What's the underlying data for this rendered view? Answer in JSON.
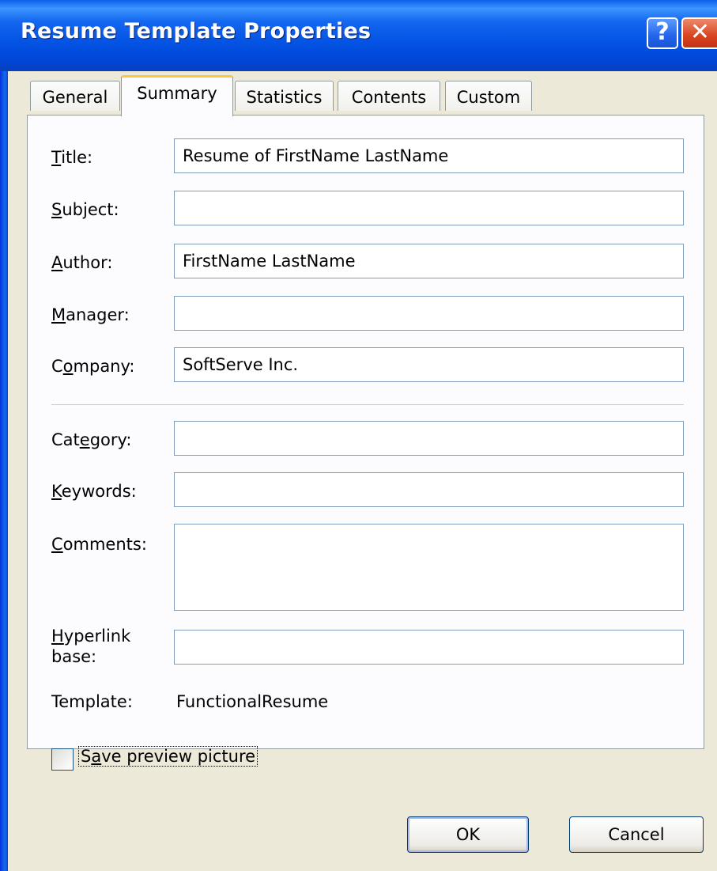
{
  "window": {
    "title": "Resume Template Properties",
    "help_glyph": "?",
    "close_glyph": "✕"
  },
  "tabs": [
    {
      "label": "General",
      "active": false
    },
    {
      "label": "Summary",
      "active": true
    },
    {
      "label": "Statistics",
      "active": false
    },
    {
      "label": "Contents",
      "active": false
    },
    {
      "label": "Custom",
      "active": false
    }
  ],
  "fields": {
    "title": {
      "label_pre": "",
      "label_u": "T",
      "label_post": "itle:",
      "value": "Resume of FirstName LastName"
    },
    "subject": {
      "label_pre": "",
      "label_u": "S",
      "label_post": "ubject:",
      "value": ""
    },
    "author": {
      "label_pre": "",
      "label_u": "A",
      "label_post": "uthor:",
      "value": "FirstName LastName"
    },
    "manager": {
      "label_pre": "",
      "label_u": "M",
      "label_post": "anager:",
      "value": ""
    },
    "company": {
      "label_pre": "C",
      "label_u": "o",
      "label_post": "mpany:",
      "value": "SoftServe Inc."
    },
    "category": {
      "label_pre": "Cat",
      "label_u": "e",
      "label_post": "gory:",
      "value": ""
    },
    "keywords": {
      "label_pre": "",
      "label_u": "K",
      "label_post": "eywords:",
      "value": ""
    },
    "comments": {
      "label_pre": "",
      "label_u": "C",
      "label_post": "omments:",
      "value": ""
    },
    "hyperlink": {
      "label_pre": "",
      "label_u": "H",
      "label_post": "yperlink",
      "label_line2": "base:",
      "value": ""
    }
  },
  "template": {
    "label": "Template:",
    "value": "FunctionalResume"
  },
  "save_preview": {
    "label_pre": "S",
    "label_u": "a",
    "label_post": "ve preview picture",
    "checked": false
  },
  "buttons": {
    "ok": "OK",
    "cancel": "Cancel"
  },
  "colors": {
    "titlebar": "#0453e4",
    "dialog_bg": "#ece9d8",
    "active_tab_highlight": "#ffc83c",
    "close_button": "#d8431f"
  }
}
